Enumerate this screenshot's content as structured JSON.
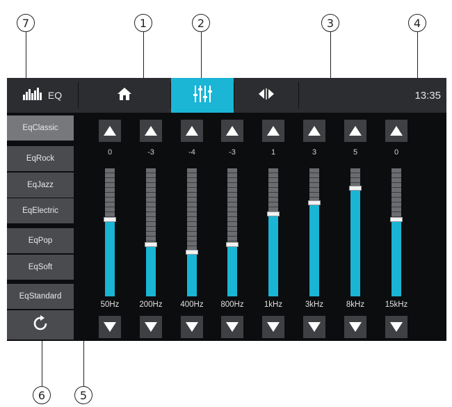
{
  "callouts": [
    "1",
    "2",
    "3",
    "4",
    "5",
    "6",
    "7"
  ],
  "topbar": {
    "eq_label": "EQ",
    "clock": "13:35",
    "icons": {
      "eq": "equalizer-icon",
      "home": "home-icon",
      "mixer": "mixer-sliders-icon",
      "balance": "balance-arrows-icon"
    },
    "accent_color": "#1bb6d6"
  },
  "presets": [
    "EqClassic",
    "EqRock",
    "EqJazz",
    "EqElectric",
    "EqPop",
    "EqSoft",
    "EqStandard"
  ],
  "active_preset": "EqClassic",
  "reset_icon": "reset-icon",
  "bands": [
    {
      "freq": "50Hz",
      "value": "0",
      "level": 0.6
    },
    {
      "freq": "200Hz",
      "value": "-3",
      "level": 0.4
    },
    {
      "freq": "400Hz",
      "value": "-4",
      "level": 0.34
    },
    {
      "freq": "800Hz",
      "value": "-3",
      "level": 0.4
    },
    {
      "freq": "1kHz",
      "value": "1",
      "level": 0.64
    },
    {
      "freq": "3kHz",
      "value": "3",
      "level": 0.73
    },
    {
      "freq": "8kHz",
      "value": "5",
      "level": 0.84
    },
    {
      "freq": "15kHz",
      "value": "0",
      "level": 0.6
    }
  ]
}
